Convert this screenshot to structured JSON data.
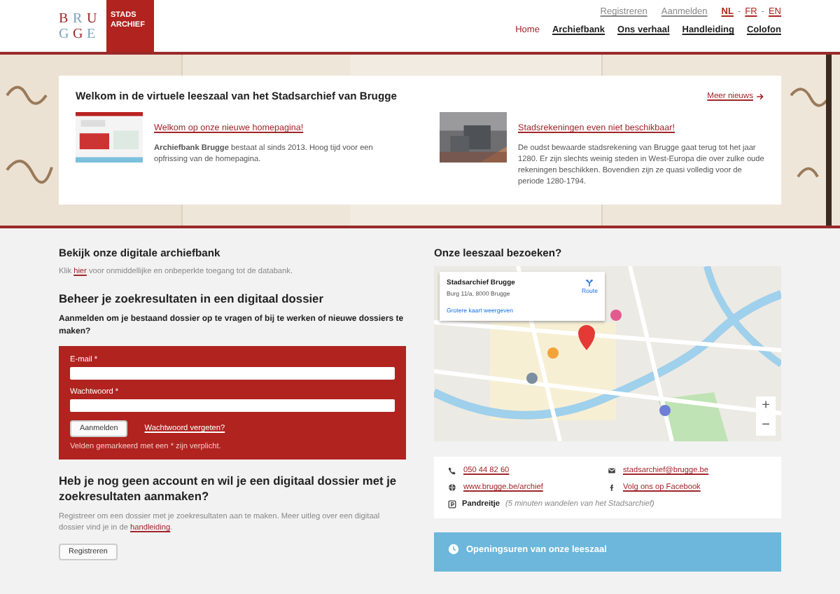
{
  "header": {
    "logo_letters": [
      "B",
      "R",
      "U",
      "G",
      "G",
      "E"
    ],
    "badge_lines": [
      "STADS",
      "ARCHIEF"
    ],
    "account_links": [
      "Registreren",
      "Aanmelden"
    ],
    "language_separator": "-",
    "languages": [
      {
        "label": "NL",
        "selected": true
      },
      {
        "label": "FR",
        "selected": false
      },
      {
        "label": "EN",
        "selected": false
      }
    ],
    "nav": [
      {
        "label": "Home",
        "selected": true
      },
      {
        "label": "Archiefbank",
        "selected": false
      },
      {
        "label": "Ons verhaal",
        "selected": false
      },
      {
        "label": "Handleiding",
        "selected": false
      },
      {
        "label": "Colofon",
        "selected": false
      }
    ]
  },
  "news": {
    "title": "Welkom in de virtuele leeszaal van het Stadsarchief van Brugge",
    "more_link": "Meer nieuws",
    "items": [
      {
        "title": "Welkom op onze nieuwe homepagina!",
        "body": "**Archiefbank Brugge** bestaat al sinds 2013. Hoog tijd voor een opfrissing van de homepagina."
      },
      {
        "title": "Stadsrekeningen even niet beschikbaar!",
        "body": "De oudst bewaarde stadsrekening van Brugge gaat terug tot het jaar 1280. Er zijn slechts weinig steden in West-Europa die over zulke oude rekeningen beschikken. Bovendien zijn ze quasi volledig voor de periode 1280-1794."
      }
    ]
  },
  "archive": {
    "title": "Bekijk onze digitale archiefbank",
    "text_before": "Klik",
    "link": "hier",
    "text_after": "voor onmiddellijke en onbeperkte toegang tot de databank."
  },
  "login": {
    "title": "Beheer je zoekresultaten in een digitaal dossier",
    "prompt": "Aanmelden om je bestaand dossier op te vragen of bij te werken of nieuwe dossiers te maken?",
    "email_label": "E-mail *",
    "password_label": "Wachtwoord *",
    "submit": "Aanmelden",
    "forgot": "Wachtwoord vergeten?",
    "note": "Velden gemarkeerd met een * zijn verplicht."
  },
  "register": {
    "title": "Heb je nog geen account en wil je een digitaal dossier met je zoekresultaten aanmaken?",
    "text_before": "Registreer om een dossier met je zoekresultaten aan te maken. Meer uitleg over een digitaal dossier vind je in de",
    "link": "handleiding",
    "text_after": ".",
    "button": "Registreren"
  },
  "visit": {
    "title": "Onze leeszaal bezoeken?",
    "map": {
      "place": "Stadsarchief Brugge",
      "address": "Burg 11/a, 8000 Brugge",
      "route": "Route",
      "larger_map": "Grotere kaart weergeven",
      "zoom_in": "+",
      "zoom_out": "−"
    },
    "contacts": [
      {
        "kind": "phone",
        "text": "050 44 82 60"
      },
      {
        "kind": "email",
        "text": "stadsarchief@brugge.be"
      },
      {
        "kind": "web",
        "text": "www.brugge.be/archief"
      },
      {
        "kind": "facebook",
        "text": "Volg ons op Facebook"
      }
    ],
    "parking": {
      "name": "Pandreitje",
      "note": "(5 minuten wandelen van het Stadsarchief)"
    },
    "hours": "Openingsuren van onze leeszaal"
  }
}
